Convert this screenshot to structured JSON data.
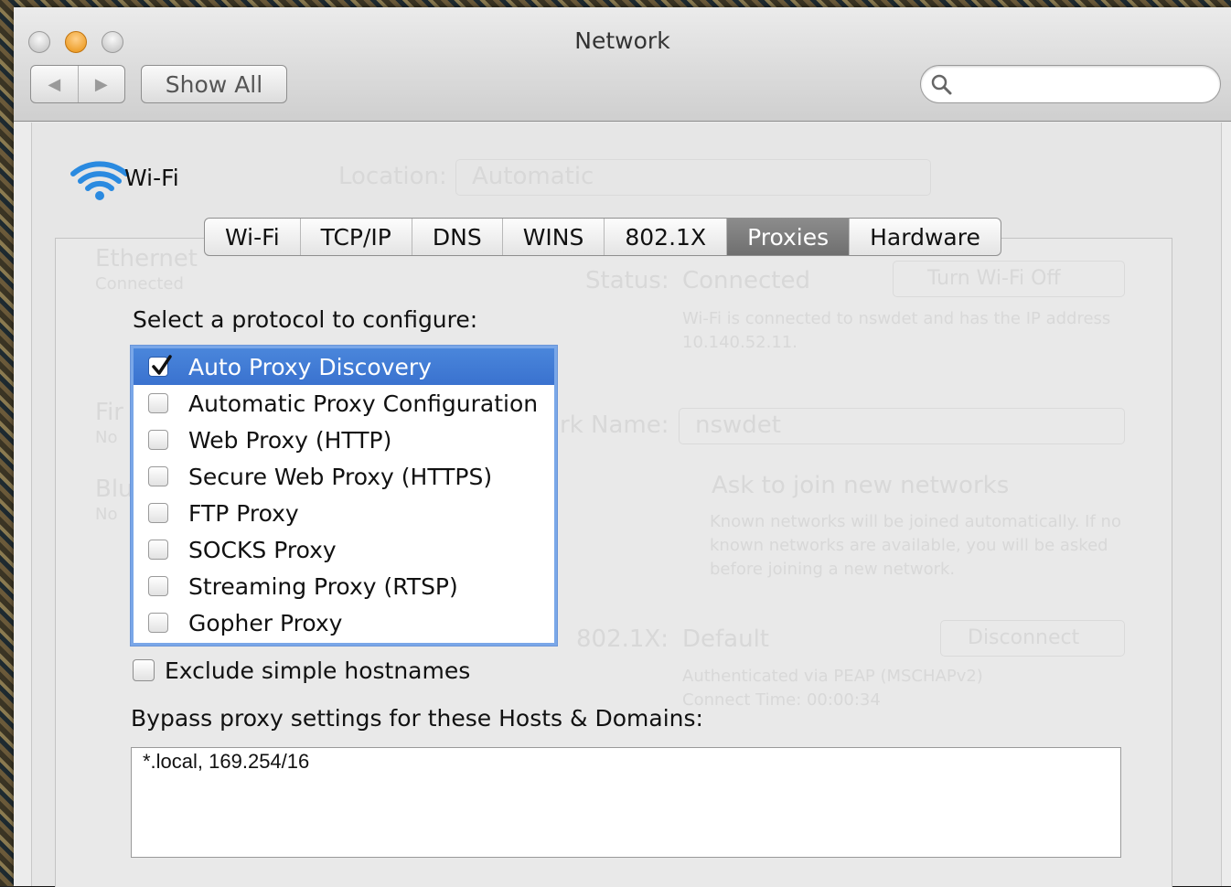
{
  "window": {
    "title": "Network",
    "show_all_label": "Show All",
    "search_placeholder": ""
  },
  "service": {
    "name": "Wi-Fi"
  },
  "background_dimmed": {
    "location_label": "Location:",
    "location_value": "Automatic",
    "sidebar": [
      {
        "name": "Ethernet",
        "status": "Connected"
      },
      {
        "name": "Fir",
        "status": "No"
      },
      {
        "name": "Blu",
        "status": "No"
      }
    ],
    "status_label": "Status:",
    "status_value": "Connected",
    "turn_off_button": "Turn Wi-Fi Off",
    "status_detail": "Wi-Fi is connected to nswdet and has the IP address 10.140.52.11.",
    "network_name_label": "rk Name:",
    "network_name_value": "nswdet",
    "ask_join_label": "Ask to join new networks",
    "ask_join_detail": "Known networks will be joined automatically. If no known networks are available, you will be asked before joining a new network.",
    "dot1x_label": "802.1X:",
    "dot1x_value": "Default",
    "disconnect_button": "Disconnect",
    "auth_detail": "Authenticated via PEAP (MSCHAPv2)",
    "connect_time": "Connect Time: 00:00:34"
  },
  "tabs": [
    {
      "label": "Wi-Fi",
      "active": false
    },
    {
      "label": "TCP/IP",
      "active": false
    },
    {
      "label": "DNS",
      "active": false
    },
    {
      "label": "WINS",
      "active": false
    },
    {
      "label": "802.1X",
      "active": false
    },
    {
      "label": "Proxies",
      "active": true
    },
    {
      "label": "Hardware",
      "active": false
    }
  ],
  "proxies": {
    "select_label": "Select a protocol to configure:",
    "protocols": [
      {
        "label": "Auto Proxy Discovery",
        "checked": true,
        "selected": true
      },
      {
        "label": "Automatic Proxy Configuration",
        "checked": false,
        "selected": false
      },
      {
        "label": "Web Proxy (HTTP)",
        "checked": false,
        "selected": false
      },
      {
        "label": "Secure Web Proxy (HTTPS)",
        "checked": false,
        "selected": false
      },
      {
        "label": "FTP Proxy",
        "checked": false,
        "selected": false
      },
      {
        "label": "SOCKS Proxy",
        "checked": false,
        "selected": false
      },
      {
        "label": "Streaming Proxy (RTSP)",
        "checked": false,
        "selected": false
      },
      {
        "label": "Gopher Proxy",
        "checked": false,
        "selected": false
      }
    ],
    "exclude_label": "Exclude simple hostnames",
    "exclude_checked": false,
    "bypass_label": "Bypass proxy settings for these Hosts & Domains:",
    "bypass_value": "*.local, 169.254/16"
  },
  "colors": {
    "selection": "#3a72cf",
    "active_tab": "#7a7a7a",
    "wifi_icon": "#2a8ae0"
  },
  "icons": [
    "close-icon",
    "minimize-icon",
    "zoom-icon",
    "back-arrow-icon",
    "forward-arrow-icon",
    "search-icon",
    "wifi-icon",
    "checkmark-icon"
  ]
}
